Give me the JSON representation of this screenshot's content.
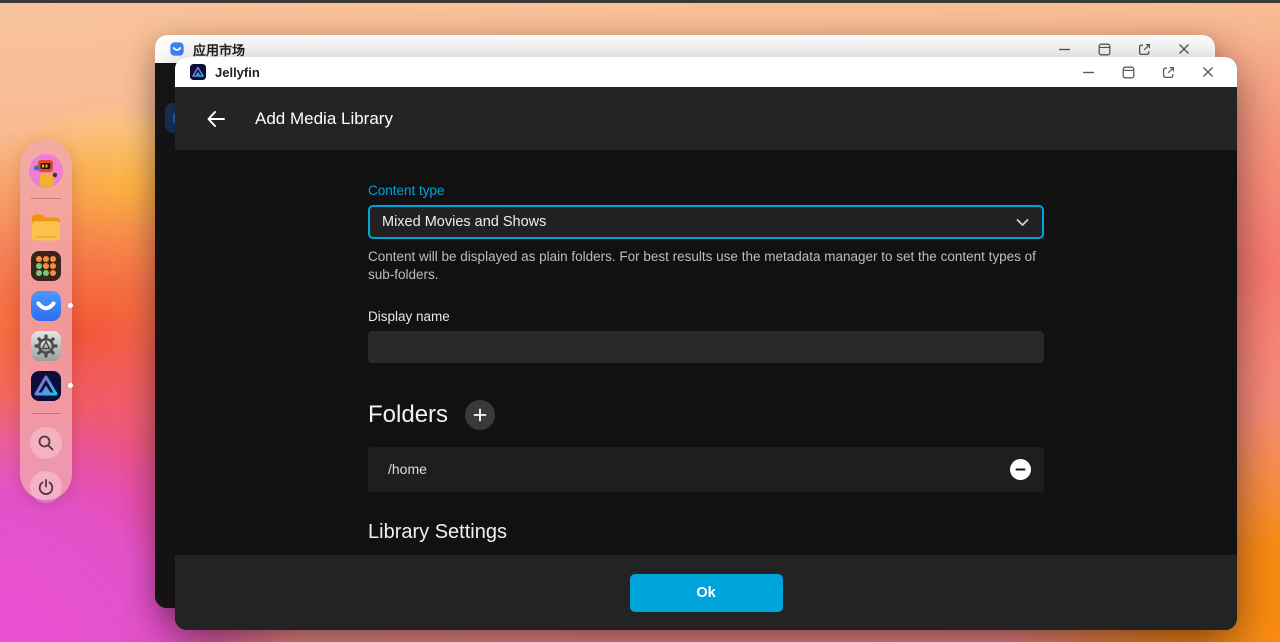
{
  "colors": {
    "accent_blue": "#00a4dc",
    "dialog_header_bg": "#242424",
    "dialog_bg": "#111111",
    "footer_bg": "#232323",
    "titlebar_bg": "#ffffff"
  },
  "dock": {
    "items": [
      {
        "name": "user-avatar"
      },
      {
        "name": "file-manager"
      },
      {
        "name": "app-launcher"
      },
      {
        "name": "app-store",
        "running": true
      },
      {
        "name": "settings"
      },
      {
        "name": "jellyfin",
        "running": true
      },
      {
        "name": "search"
      },
      {
        "name": "power"
      }
    ]
  },
  "app_market_window": {
    "title": "应用市场"
  },
  "jellyfin_window": {
    "title": "Jellyfin",
    "dialog": {
      "title": "Add Media Library",
      "content_type_label": "Content type",
      "content_type_value": "Mixed Movies and Shows",
      "content_type_help": "Content will be displayed as plain folders. For best results use the metadata manager to set the content types of sub-folders.",
      "display_name_label": "Display name",
      "display_name_value": "",
      "folders_heading": "Folders",
      "folders": [
        "/home"
      ],
      "library_settings_heading": "Library Settings",
      "ok_button_label": "Ok"
    }
  }
}
